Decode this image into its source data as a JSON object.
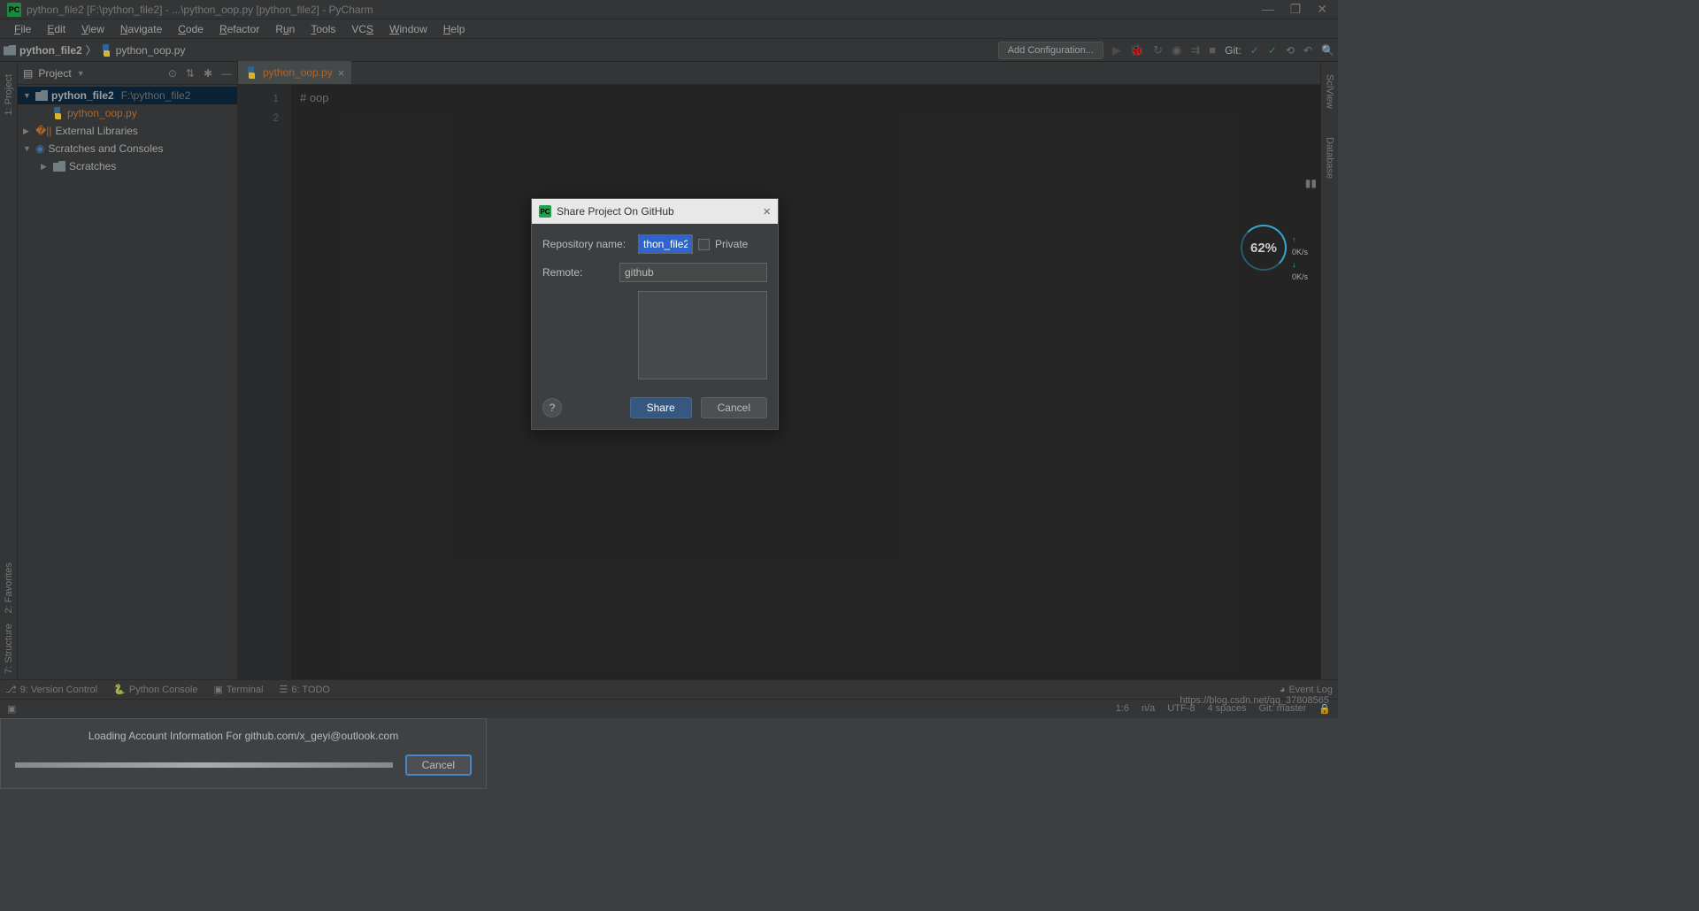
{
  "titlebar": {
    "text": "python_file2 [F:\\python_file2] - ...\\python_oop.py [python_file2] - PyCharm"
  },
  "menubar": {
    "file": "File",
    "edit": "Edit",
    "view": "View",
    "navigate": "Navigate",
    "code": "Code",
    "refactor": "Refactor",
    "run": "Run",
    "tools": "Tools",
    "vcs": "VCS",
    "window": "Window",
    "help": "Help"
  },
  "navbar": {
    "crumb1": "python_file2",
    "crumb2": "python_oop.py",
    "add_config": "Add Configuration...",
    "git": "Git:"
  },
  "left_gutter": {
    "project": "1: Project",
    "favorites": "2: Favorites",
    "structure": "7: Structure"
  },
  "right_gutter": {
    "sciview": "SciView",
    "database": "Database"
  },
  "project_panel": {
    "title": "Project",
    "root": "python_file2",
    "root_path": "F:\\python_file2",
    "file1": "python_oop.py",
    "ext_lib": "External Libraries",
    "scratches": "Scratches and Consoles",
    "scratches_sub": "Scratches"
  },
  "tab": {
    "name": "python_oop.py"
  },
  "code": {
    "l1": "1",
    "l2": "2",
    "content": "# oop"
  },
  "share_dialog": {
    "title": "Share Project On GitHub",
    "repo_label": "Repository name:",
    "repo_value": "thon_file2",
    "private": "Private",
    "remote_label": "Remote:",
    "remote_value": "github",
    "share_btn": "Share",
    "cancel_btn": "Cancel"
  },
  "loading_dialog": {
    "text": "Loading Account Information For github.com/x_geyi@outlook.com",
    "cancel": "Cancel"
  },
  "net": {
    "pct": "62%",
    "up": "0K/s",
    "dn": "0K/s"
  },
  "bottom_tabs": {
    "vc": "9: Version Control",
    "pyconsole": "Python Console",
    "terminal": "Terminal",
    "todo": "6: TODO",
    "eventlog": "Event Log"
  },
  "status": {
    "pos": "1:6",
    "na": "n/a",
    "enc": "UTF-8",
    "indent": "4 spaces",
    "branch": "Git: master"
  },
  "watermark": "https://blog.csdn.net/qq_37808565"
}
